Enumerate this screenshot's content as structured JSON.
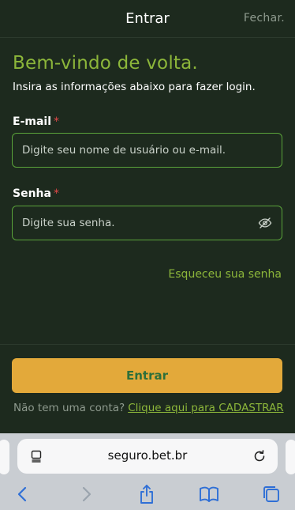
{
  "header": {
    "title": "Entrar",
    "close_label": "Fechar."
  },
  "welcome": {
    "title": "Bem-vindo de volta.",
    "subtitle": "Insira as informações abaixo para fazer login."
  },
  "form": {
    "email_label": "E-mail",
    "email_required": "*",
    "email_placeholder": "Digite seu nome de usuário ou e-mail.",
    "email_value": "",
    "password_label": "Senha",
    "password_required": "*",
    "password_placeholder": "Digite sua senha.",
    "password_value": "",
    "forgot_label": "Esqueceu sua senha",
    "submit_label": "Entrar",
    "no_account_text": "Não tem uma conta?",
    "register_link": "Clique aqui para CADASTRAR"
  },
  "browser": {
    "url": "seguro.bet.br"
  },
  "colors": {
    "background": "#1d2a1e",
    "accent_green": "#8cb63a",
    "field_border": "#5aa33a",
    "button_bg": "#e3a93a",
    "button_text": "#2e6f3a",
    "required": "#e04848"
  },
  "icons": {
    "password_toggle": "eye-slash-icon",
    "url_left": "page-menu-icon",
    "url_right": "reload-icon",
    "toolbar": [
      "back-icon",
      "forward-icon",
      "share-icon",
      "bookmarks-icon",
      "tabs-icon"
    ]
  }
}
